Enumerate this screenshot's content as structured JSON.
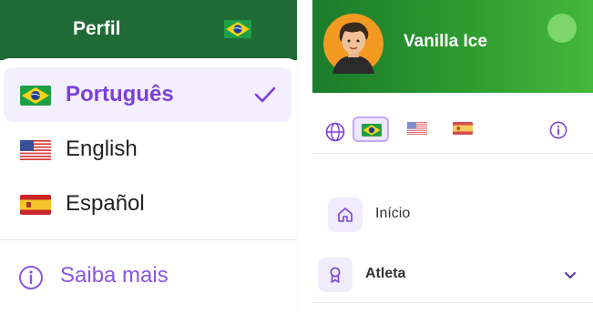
{
  "left_panel": {
    "header": {
      "title": "Perfil",
      "flag_icon": "brazil-flag-icon",
      "bg_color": "#1f6a35"
    },
    "languages": [
      {
        "label": "Português",
        "flag": "brazil-flag-icon",
        "selected": true
      },
      {
        "label": "English",
        "flag": "usa-flag-icon",
        "selected": false
      },
      {
        "label": "Español",
        "flag": "spain-flag-icon",
        "selected": false
      }
    ],
    "more": {
      "label": "Saiba mais",
      "icon": "info-icon"
    },
    "accent_color": "#7b3fd8"
  },
  "right_panel": {
    "user": {
      "name": "Vanilla Ice",
      "avatar": "avatar-icon"
    },
    "language_flags": [
      "brazil-flag-icon",
      "usa-flag-icon",
      "spain-flag-icon"
    ],
    "nav": [
      {
        "label": "Início",
        "icon": "home-icon"
      },
      {
        "label": "Atleta",
        "icon": "medal-icon",
        "expandable": true
      }
    ],
    "header_gradient": [
      "#1b7b2c",
      "#46b83b"
    ]
  }
}
